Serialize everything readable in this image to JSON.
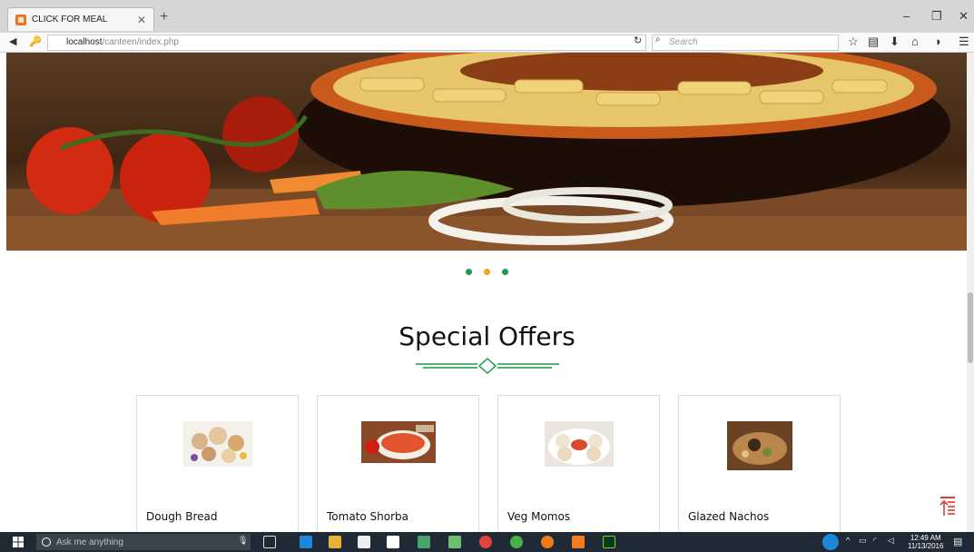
{
  "browser": {
    "tab_title": "CLICK FOR MEAL",
    "url_host": "localhost",
    "url_path": "/canteen/index.php",
    "search_placeholder": "Search"
  },
  "hero": {
    "slide_count": 3,
    "active_slide": 2
  },
  "colors": {
    "accent_green": "#1a9a4a",
    "dot_orange": "#f2a21b",
    "totop_red": "#e23b2f"
  },
  "section": {
    "title": "Special Offers"
  },
  "offers": [
    {
      "name": "Dough Bread"
    },
    {
      "name": "Tomato Shorba"
    },
    {
      "name": "Veg Momos"
    },
    {
      "name": "Glazed Nachos"
    }
  ],
  "taskbar": {
    "search_placeholder": "Ask me anything",
    "time": "12:49 AM",
    "date": "11/13/2016"
  }
}
